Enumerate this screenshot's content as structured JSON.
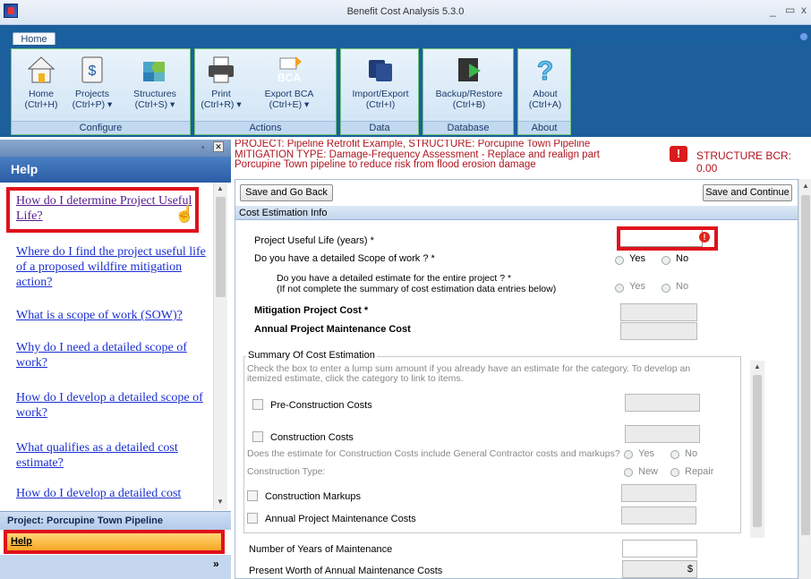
{
  "window": {
    "title": "Benefit Cost Analysis 5.3.0",
    "min_icon": "minimize-icon",
    "restore_icon": "restore-icon",
    "close_icon": "close-icon"
  },
  "ribbon": {
    "tab": "Home",
    "groups": [
      {
        "label": "Configure",
        "buttons": [
          {
            "label": "Home",
            "shortcut": "(Ctrl+H)",
            "icon": "house-icon"
          },
          {
            "label": "Projects",
            "shortcut": "(Ctrl+P) ▾",
            "icon": "dollar-document-icon"
          },
          {
            "label": "Structures",
            "shortcut": "(Ctrl+S) ▾",
            "icon": "puzzle-icon"
          }
        ]
      },
      {
        "label": "Actions",
        "buttons": [
          {
            "label": "Print",
            "shortcut": "(Ctrl+R) ▾",
            "icon": "printer-icon"
          },
          {
            "label": "Export BCA",
            "shortcut": "(Ctrl+E) ▾",
            "icon": "export-bca-icon",
            "badge": "BCA"
          }
        ]
      },
      {
        "label": "Data",
        "buttons": [
          {
            "label": "Import/Export",
            "shortcut": "(Ctrl+I)",
            "icon": "import-export-icon"
          }
        ]
      },
      {
        "label": "Database",
        "buttons": [
          {
            "label": "Backup/Restore",
            "shortcut": "(Ctrl+B)",
            "icon": "backup-restore-icon"
          }
        ]
      },
      {
        "label": "About",
        "buttons": [
          {
            "label": "About",
            "shortcut": "(Ctrl+A)",
            "icon": "question-icon"
          }
        ]
      }
    ]
  },
  "help_panel": {
    "title": "Help",
    "links": [
      "How do I determine Project Useful Life?",
      "Where do I find the project useful life of a proposed wildfire mitigation action?",
      "What is a scope of work (SOW)?",
      "Why do I need a detailed scope of work?",
      "How do I develop a detailed scope of work?",
      "What qualifies as a detailed cost estimate?",
      "How do I develop a detailed cost"
    ],
    "nav_project": "Project: Porcupine Town Pipeline",
    "nav_help": "Help"
  },
  "header": {
    "project_line": "PROJECT: Pipeline Retrofit Example, STRUCTURE: Porcupine Town Pipeline",
    "mitigation_line": "MITIGATION TYPE: Damage-Frequency Assessment - Replace and realign part",
    "desc_line": "Porcupine Town pipeline to reduce risk from flood erosion damage",
    "bcr_label": "STRUCTURE BCR: 0.00"
  },
  "form": {
    "save_back": "Save and Go Back",
    "save_continue": "Save and Continue",
    "section_title": "Cost Estimation Info",
    "useful_life_label": "Project Useful Life (years) *",
    "useful_life_value": "",
    "scope_question": "Do you have a detailed Scope of work ? *",
    "estimate_question": "Do you have a detailed estimate for the entire project ? *",
    "estimate_note": "(If not complete the summary of cost estimation data entries below)",
    "yes": "Yes",
    "no": "No",
    "mitigation_cost_label": "Mitigation Project Cost",
    "required_mark": "*",
    "annual_cost_label": "Annual Project Maintenance Cost",
    "summary_legend": "Summary Of Cost Estimation",
    "summary_instructions": "Check the box to enter a lump sum amount if you already have an estimate for the category. To develop an itemized estimate, click the category to link to items.",
    "pre_construction": "Pre-Construction Costs",
    "construction": "Construction Costs",
    "gc_question": "Does the estimate for Construction Costs include General Contractor costs and markups?",
    "construction_type": "Construction Type:",
    "new": "New",
    "repair": "Repair",
    "construction_markups": "Construction Markups",
    "annual_maintenance_costs": "Annual Project Maintenance Costs",
    "years_maintenance": "Number of Years of Maintenance",
    "present_worth": "Present Worth of Annual Maintenance Costs",
    "currency": "$"
  }
}
